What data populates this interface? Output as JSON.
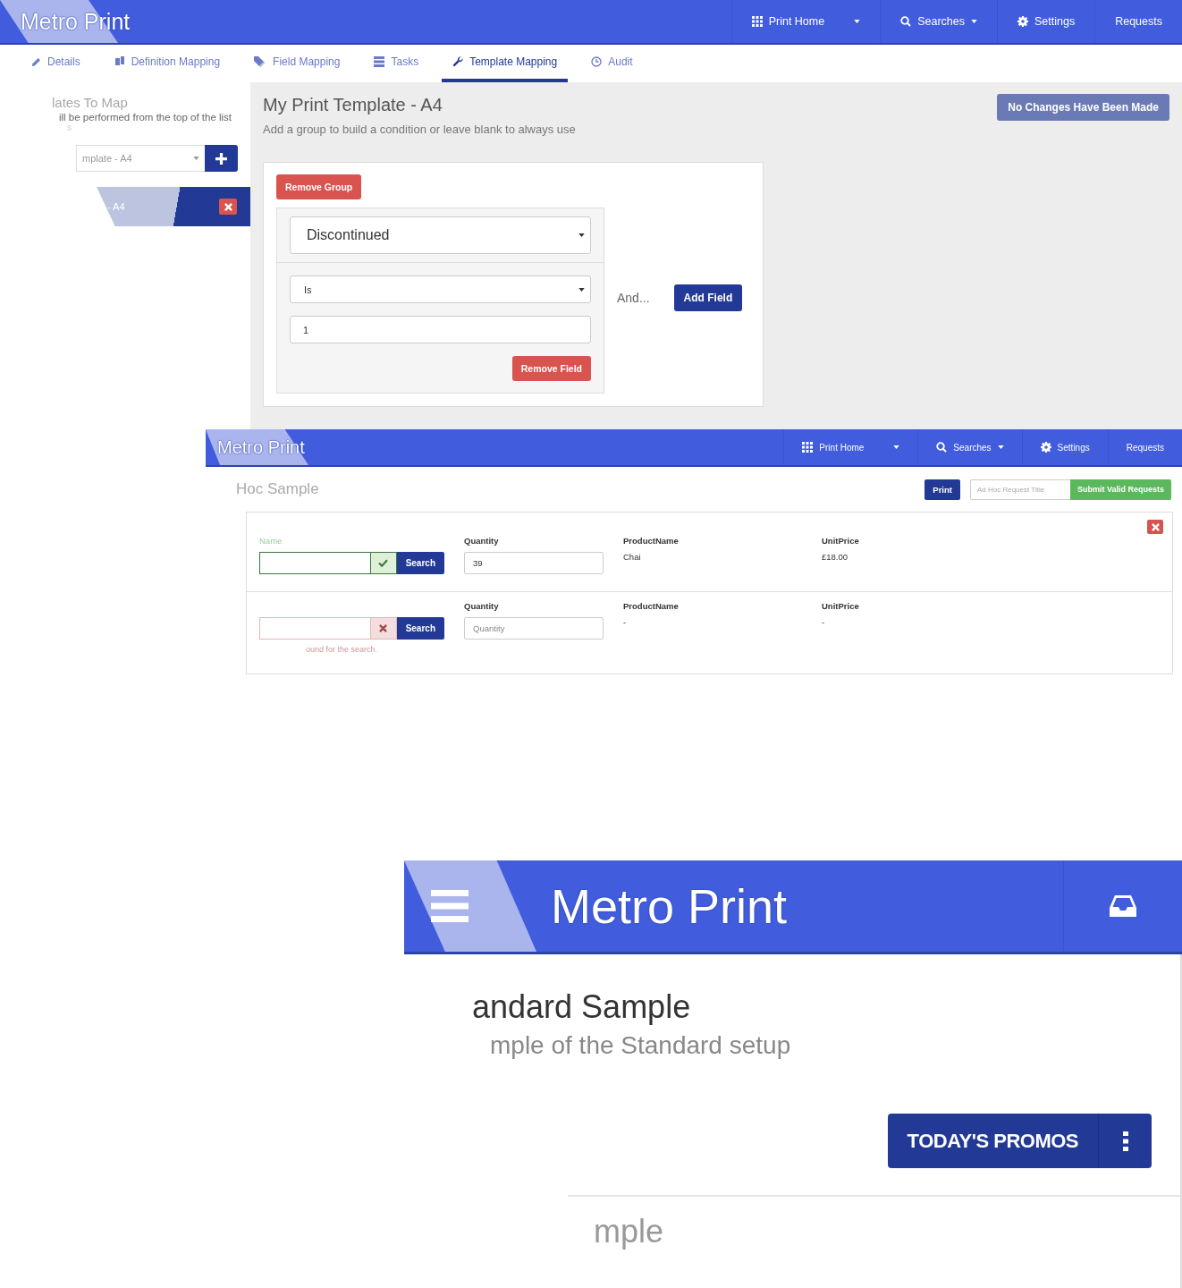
{
  "template_screen": {
    "header": {
      "brand": "Metro Print",
      "nav": [
        {
          "label": "Print Home",
          "dropdown": true
        },
        {
          "label": "Searches",
          "dropdown": true
        },
        {
          "label": "Settings",
          "dropdown": false
        },
        {
          "label": "Requests",
          "dropdown": false
        }
      ]
    },
    "tabs": [
      {
        "label": "Details",
        "selected": false
      },
      {
        "label": "Definition Mapping",
        "selected": false
      },
      {
        "label": "Field Mapping",
        "selected": false
      },
      {
        "label": "Tasks",
        "selected": false
      },
      {
        "label": "Template Mapping",
        "selected": true
      },
      {
        "label": "Audit",
        "selected": false
      }
    ],
    "sidebar": {
      "heading": "lates To Map",
      "note": "ill be performed from the top of the list",
      "note_2": "s",
      "template_select": "mplate - A4",
      "items": [
        {
          "label": "- A4",
          "selected": true
        }
      ]
    },
    "main": {
      "title": "My Print Template - A4",
      "subtitle": "Add a group to build a condition or leave blank to always use",
      "status_button": {
        "label": "No Changes Have Been Made",
        "disabled": true
      },
      "group": {
        "remove_group": "Remove Group",
        "field_select": "Discontinued",
        "operator_select": "Is",
        "value": "1",
        "remove_field": "Remove Field",
        "and_label": "And...",
        "add_field": "Add Field"
      }
    }
  },
  "adhoc_screen": {
    "header": {
      "brand": "Metro Print",
      "nav": [
        {
          "label": "Print Home",
          "dropdown": true
        },
        {
          "label": "Searches",
          "dropdown": true
        },
        {
          "label": "Settings",
          "dropdown": false
        },
        {
          "label": "Requests",
          "dropdown": false
        }
      ]
    },
    "title": "Hoc Sample",
    "print_button": "Print",
    "request_title": {
      "placeholder": "Ad Hoc Request Title"
    },
    "submit_button": "Submit Valid Requests",
    "rows": [
      {
        "search_label": "Name",
        "valid": true,
        "search_button": "Search",
        "quantity_label": "Quantity",
        "quantity": {
          "value": "39"
        },
        "product_label": "ProductName",
        "product": "Chai",
        "price_label": "UnitPrice",
        "price": "£18.00"
      },
      {
        "valid": false,
        "search_button": "Search",
        "error": "ound for the search.",
        "quantity_label": "Quantity",
        "quantity": {
          "placeholder": "Quantity"
        },
        "product_label": "ProductName",
        "product": "-",
        "price_label": "UnitPrice",
        "price": "-"
      }
    ]
  },
  "standard_screen": {
    "header": {
      "brand": "Metro Print"
    },
    "title": "andard Sample",
    "subtitle": "mple of the Standard setup",
    "promos_button": "TODAY'S PROMOS",
    "next_title": "mple"
  }
}
